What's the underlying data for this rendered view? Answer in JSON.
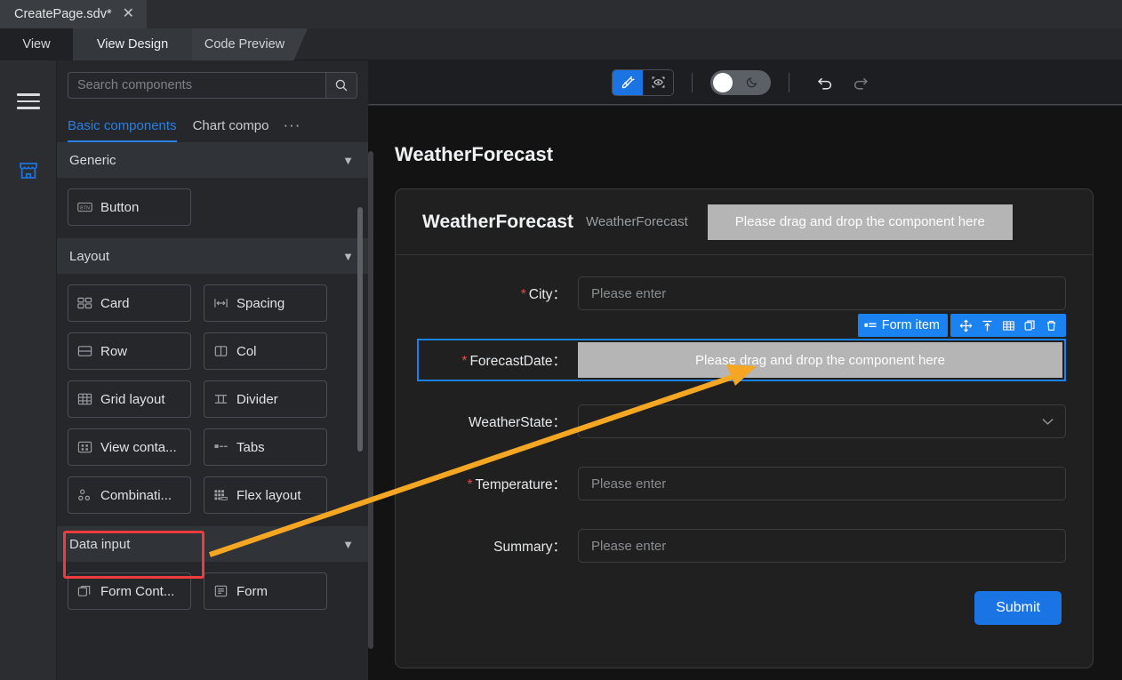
{
  "window": {
    "file_tab": {
      "label": "CreatePage.sdv*",
      "close_icon": "close-icon"
    }
  },
  "view_tabs": [
    {
      "label": "View",
      "state": "plain"
    },
    {
      "label": "View Design",
      "state": "active"
    },
    {
      "label": "Code Preview",
      "state": "slant"
    }
  ],
  "rail": {
    "menu_icon": "hamburger-icon",
    "store_icon": "store-icon",
    "store_color": "#1b74e4"
  },
  "palette": {
    "search": {
      "value": "",
      "placeholder": "Search components",
      "icon": "search-icon"
    },
    "tabs": [
      {
        "label": "Basic components",
        "active": true
      },
      {
        "label": "Chart compo",
        "active": false
      }
    ],
    "more_label": "···",
    "groups": [
      {
        "title": "Generic",
        "chevron": "chevron-down-icon",
        "items": [
          {
            "label": "Button",
            "icon": "button-icon"
          }
        ]
      },
      {
        "title": "Layout",
        "chevron": "chevron-down-icon",
        "items": [
          {
            "label": "Card",
            "icon": "card-icon"
          },
          {
            "label": "Spacing",
            "icon": "spacing-icon"
          },
          {
            "label": "Row",
            "icon": "row-icon"
          },
          {
            "label": "Col",
            "icon": "col-icon"
          },
          {
            "label": "Grid layout",
            "icon": "grid-layout-icon"
          },
          {
            "label": "Divider",
            "icon": "divider-icon"
          },
          {
            "label": "View conta...",
            "icon": "view-container-icon"
          },
          {
            "label": "Tabs",
            "icon": "tabs-icon"
          },
          {
            "label": "Combinati...",
            "icon": "combination-icon"
          },
          {
            "label": "Flex layout",
            "icon": "flex-layout-icon"
          }
        ]
      },
      {
        "title": "Data input",
        "chevron": "chevron-down-icon",
        "items": [
          {
            "label": "Form Cont...",
            "icon": "form-container-icon"
          },
          {
            "label": "Form",
            "icon": "form-icon"
          }
        ]
      }
    ],
    "highlight": {
      "target": "Combinati...",
      "color": "#ee3b3b"
    }
  },
  "toolbar": {
    "design_mode_icon": "design-pen-icon",
    "preview_mode_icon": "preview-eye-icon",
    "theme_toggle_icon": "moon-icon",
    "undo_icon": "undo-icon",
    "redo_icon": "redo-icon",
    "accent": "#1b74e4"
  },
  "canvas": {
    "page_title": "WeatherForecast",
    "card": {
      "title": "WeatherForecast",
      "subtitle": "WeatherForecast",
      "header_dropzone": "Please drag and drop the component here"
    },
    "fields": [
      {
        "label": "City：",
        "required": true,
        "type": "input",
        "value": "",
        "placeholder": "Please enter",
        "selected": false
      },
      {
        "label": "ForecastDate：",
        "required": true,
        "type": "dropzone",
        "value": "Please drag and drop the component here",
        "placeholder": "",
        "selected": true
      },
      {
        "label": "WeatherState：",
        "required": false,
        "type": "select",
        "value": "",
        "placeholder": "",
        "selected": false
      },
      {
        "label": "Temperature：",
        "required": true,
        "type": "input",
        "value": "",
        "placeholder": "Please enter",
        "selected": false
      },
      {
        "label": "Summary：",
        "required": false,
        "type": "input",
        "value": "",
        "placeholder": "Please enter",
        "selected": false
      }
    ],
    "item_toolbar": {
      "tag_label": "Form item",
      "tag_icon": "form-item-icon",
      "actions": [
        {
          "icon": "move-icon"
        },
        {
          "icon": "select-parent-icon"
        },
        {
          "icon": "table-icon"
        },
        {
          "icon": "copy-icon"
        },
        {
          "icon": "delete-icon"
        }
      ]
    },
    "submit_label": "Submit",
    "selection_color": "#1b82f2"
  },
  "annotation": {
    "arrow_color": "#f5a623",
    "from": "Combinati...",
    "to": "ForecastDate dropzone"
  }
}
